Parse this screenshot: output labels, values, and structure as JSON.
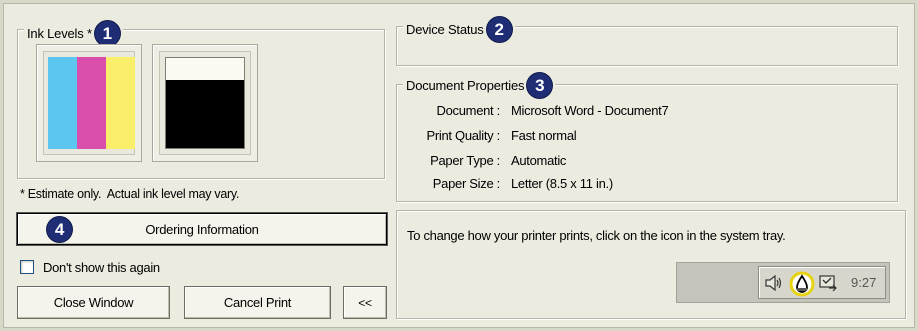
{
  "ink_levels": {
    "label": "Ink Levels *",
    "callout": "1",
    "tricolor_colors": [
      "#5cc6ee",
      "#db4fac",
      "#f9ef6a"
    ],
    "black_color": "#000000",
    "black_level_percent": 76
  },
  "device_status": {
    "label": "Device Status",
    "callout": "2"
  },
  "document_properties": {
    "label": "Document Properties",
    "callout": "3",
    "rows": [
      {
        "label": "Document :",
        "value": "Microsoft Word - Document7"
      },
      {
        "label": "Print Quality :",
        "value": "Fast normal"
      },
      {
        "label": "Paper Type :",
        "value": "Automatic"
      },
      {
        "label": "Paper Size :",
        "value": "Letter (8.5 x 11 in.)"
      }
    ]
  },
  "estimate_note": "* Estimate only.  Actual ink level may vary.",
  "ordering": {
    "callout": "4",
    "label": "Ordering Information"
  },
  "dont_show": {
    "label": "Don't show this again",
    "checked": false
  },
  "buttons": {
    "close": "Close Window",
    "cancel": "Cancel Print",
    "collapse": "<<"
  },
  "info_text": "To change how your printer prints, click on the icon in the system tray.",
  "tray": {
    "time": "9:27",
    "icons": [
      "speaker-icon",
      "printer-tray-icon",
      "network-icon"
    ]
  }
}
